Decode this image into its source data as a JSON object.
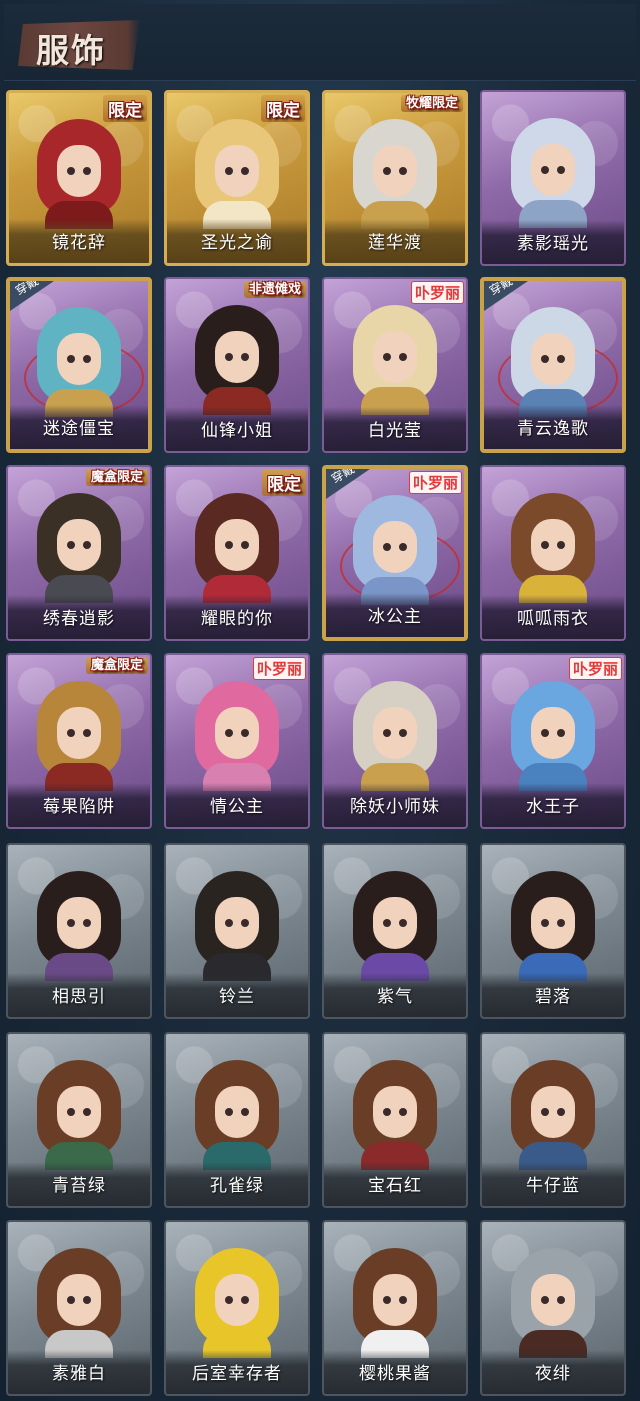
{
  "header": {
    "title": "服饰"
  },
  "colors": {
    "background": "#1b2a3a",
    "gold_frame": "#d4ad54",
    "purple_frame": "#8f6aa8",
    "gray_frame": "#7d8891",
    "tag_red": "#e23a3a"
  },
  "costumes": [
    {
      "name": "镜花辞",
      "frame": "gold",
      "tag": "限定",
      "worn": false,
      "hair": "#a8272a",
      "body": "#7d1a1c"
    },
    {
      "name": "圣光之谕",
      "frame": "gold",
      "tag": "限定",
      "worn": false,
      "hair": "#e9c77a",
      "body": "#f3e6c7"
    },
    {
      "name": "莲华渡",
      "frame": "gold",
      "tag": "牧耀限定",
      "worn": false,
      "hair": "#d9d6cf",
      "body": "#c9a14e"
    },
    {
      "name": "素影瑶光",
      "frame": "purple",
      "tag": "",
      "worn": false,
      "hair": "#cfd8e8",
      "body": "#8ea4c6"
    },
    {
      "name": "迷途僵宝",
      "frame": "gold-purple",
      "tag": "",
      "worn": true,
      "hair": "#5fb3c3",
      "body": "#c9a14e"
    },
    {
      "name": "仙锋小姐",
      "frame": "purple",
      "tag": "非遗傩戏",
      "worn": false,
      "hair": "#2a1e1c",
      "body": "#8a2a22"
    },
    {
      "name": "白光莹",
      "frame": "purple",
      "tag": "卟罗丽",
      "worn": false,
      "hair": "#e8d6a8",
      "body": "#c9a14e"
    },
    {
      "name": "青云逸歌",
      "frame": "gold-purple",
      "tag": "",
      "worn": true,
      "hair": "#cdd8e6",
      "body": "#5a82b4"
    },
    {
      "name": "绣春逍影",
      "frame": "purple",
      "tag": "魔盒限定",
      "worn": false,
      "hair": "#3a3026",
      "body": "#4a4a52"
    },
    {
      "name": "耀眼的你",
      "frame": "purple",
      "tag": "限定",
      "worn": false,
      "hair": "#5a2a22",
      "body": "#b02a38"
    },
    {
      "name": "冰公主",
      "frame": "gold-purple",
      "tag": "卟罗丽",
      "worn": true,
      "hair": "#9fb8e0",
      "body": "#7a96c8"
    },
    {
      "name": "呱呱雨衣",
      "frame": "purple",
      "tag": "",
      "worn": false,
      "hair": "#7a4a2a",
      "body": "#d9b23a"
    },
    {
      "name": "莓果陷阱",
      "frame": "purple",
      "tag": "魔盒限定",
      "worn": false,
      "hair": "#b8863a",
      "body": "#8a2a22"
    },
    {
      "name": "情公主",
      "frame": "purple",
      "tag": "卟罗丽",
      "worn": false,
      "hair": "#e06aa0",
      "body": "#d880b0"
    },
    {
      "name": "除妖小师妹",
      "frame": "purple",
      "tag": "",
      "worn": false,
      "hair": "#d6cfc4",
      "body": "#c9a14e"
    },
    {
      "name": "水王子",
      "frame": "purple",
      "tag": "卟罗丽",
      "worn": false,
      "hair": "#6aa6e0",
      "body": "#4a82c0"
    },
    {
      "name": "相思引",
      "frame": "gray",
      "tag": "",
      "worn": false,
      "hair": "#2a1e1c",
      "body": "#6a4a86"
    },
    {
      "name": "铃兰",
      "frame": "gray",
      "tag": "",
      "worn": false,
      "hair": "#2a2420",
      "body": "#2a2a2e"
    },
    {
      "name": "紫气",
      "frame": "gray",
      "tag": "",
      "worn": false,
      "hair": "#2a1e1c",
      "body": "#6a4aa6"
    },
    {
      "name": "碧落",
      "frame": "gray",
      "tag": "",
      "worn": false,
      "hair": "#2a1e1c",
      "body": "#3a6ab8"
    },
    {
      "name": "青苔绿",
      "frame": "gray",
      "tag": "",
      "worn": false,
      "hair": "#6a3e26",
      "body": "#3a6a4a"
    },
    {
      "name": "孔雀绿",
      "frame": "gray",
      "tag": "",
      "worn": false,
      "hair": "#6a3e26",
      "body": "#2a6a6a"
    },
    {
      "name": "宝石红",
      "frame": "gray",
      "tag": "",
      "worn": false,
      "hair": "#6a3e26",
      "body": "#8a2a2a"
    },
    {
      "name": "牛仔蓝",
      "frame": "gray",
      "tag": "",
      "worn": false,
      "hair": "#6a3e26",
      "body": "#3a5a8a"
    },
    {
      "name": "素雅白",
      "frame": "gray",
      "tag": "",
      "worn": false,
      "hair": "#6a3e26",
      "body": "#c8c8c8"
    },
    {
      "name": "后室幸存者",
      "frame": "gray",
      "tag": "",
      "worn": false,
      "hair": "#e8c62a",
      "body": "#e8c62a"
    },
    {
      "name": "樱桃果酱",
      "frame": "gray",
      "tag": "",
      "worn": false,
      "hair": "#6a3e26",
      "body": "#f0f0f0"
    },
    {
      "name": "夜绯",
      "frame": "gray",
      "tag": "",
      "worn": false,
      "hair": "#9aa2aa",
      "body": "#4a2a22"
    }
  ],
  "labels": {
    "worn_badge": "穿戴"
  }
}
